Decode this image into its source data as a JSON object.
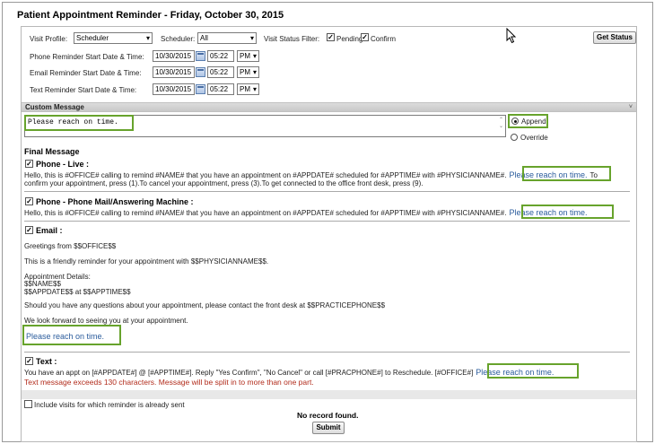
{
  "title": "Patient Appointment Reminder - Friday, October 30, 2015",
  "filters": {
    "visit_profile_label": "Visit Profile:",
    "visit_profile_value": "Scheduler",
    "scheduler_label": "Scheduler:",
    "scheduler_value": "All",
    "status_filter_label": "Visit Status Filter:",
    "pending_label": "Pending",
    "confirm_label": "Confirm",
    "get_status_label": "Get Status"
  },
  "start_times": [
    {
      "label": "Phone Reminder Start Date & Time:",
      "date": "10/30/2015",
      "time": "05:22",
      "ampm": "PM"
    },
    {
      "label": "Email Reminder Start Date & Time:",
      "date": "10/30/2015",
      "time": "05:22",
      "ampm": "PM"
    },
    {
      "label": "Text Reminder Start Date & Time:",
      "date": "10/30/2015",
      "time": "05:22",
      "ampm": "PM"
    }
  ],
  "custom_message": {
    "header": "Custom Message",
    "collapse_glyph": "˅",
    "text": "Please reach on time.",
    "append_label": "Append",
    "override_label": "Override",
    "mode": "Append"
  },
  "final_message": {
    "header": "Final Message",
    "phone_live": {
      "label": "Phone - Live :",
      "line1": "Hello, this is #OFFICE# calling to remind #NAME# that you have an appointment on #APPDATE# scheduled for #APPTIME# with #PHYSICIANNAME#.",
      "custom": "Please reach on time.",
      "line1_end": "To",
      "line2": "confirm your appointment, press (1).To cancel your appointment, press (3).To get connected to the office front desk, press (9)."
    },
    "phone_mail": {
      "label": "Phone - Phone Mail/Answering Machine :",
      "line1": "Hello, this is #OFFICE# calling to remind #NAME# that you have an appointment on #APPDATE# scheduled for #APPTIME# with #PHYSICIANNAME#.",
      "custom": "Please reach on time."
    },
    "email": {
      "label": "Email :",
      "greeting": "Greetings from $$OFFICE$$",
      "reminder": "This is a friendly reminder for your appointment with $$PHYSICIANNAME$$.",
      "details_header": "Appointment Details:",
      "details_name": "$$NAME$$",
      "details_when": "$$APPDATE$$ at $$APPTIME$$",
      "questions": "Should you have any questions about your appointment, please contact the front desk at $$PRACTICEPHONE$$",
      "closing": "We look forward to seeing you at your appointment.",
      "custom": "Please reach on time."
    },
    "text": {
      "label": "Text :",
      "line1": "You have an appt on [#APPDATE#] @ [#APPTIME#]. Reply \"Yes Confirm\", \"No Cancel\" or call [#PRACPHONE#] to Reschedule. [#OFFICE#]",
      "custom": "Please reach on time.",
      "warning": "Text message exceeds 130 characters. Message will be split in to more than one part."
    }
  },
  "include_sent_label": "Include visits for which reminder is already sent",
  "no_record": "No record found.",
  "submit_label": "Submit"
}
